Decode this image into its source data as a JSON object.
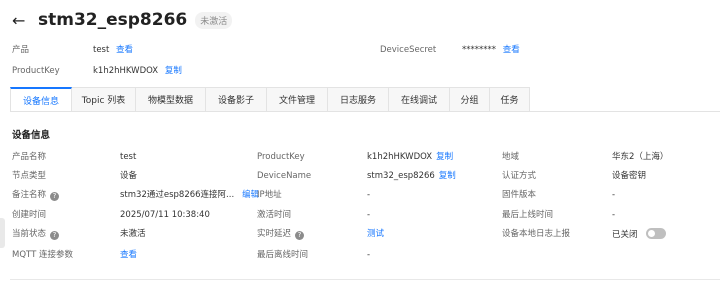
{
  "header": {
    "back_glyph": "←",
    "title": "stm32_esp8266",
    "status": "未激活"
  },
  "meta": {
    "product_label": "产品",
    "product_value": "test",
    "product_link": "查看",
    "secret_label": "DeviceSecret",
    "secret_value": "********",
    "secret_link": "查看",
    "productkey_label": "ProductKey",
    "productkey_value": "k1h2hHKWDOX",
    "productkey_link": "复制"
  },
  "tabs": [
    "设备信息",
    "Topic 列表",
    "物模型数据",
    "设备影子",
    "文件管理",
    "日志服务",
    "在线调试",
    "分组",
    "任务"
  ],
  "section": {
    "title": "设备信息"
  },
  "info": {
    "product_name_label": "产品名称",
    "product_name_value": "test",
    "pk_label": "ProductKey",
    "pk_value": "k1h2hHKWDOX",
    "pk_link": "复制",
    "region_label": "地域",
    "region_value": "华东2（上海）",
    "node_label": "节点类型",
    "node_value": "设备",
    "devname_label": "DeviceName",
    "devname_value": "stm32_esp8266",
    "devname_link": "复制",
    "auth_label": "认证方式",
    "auth_value": "设备密钥",
    "remark_label": "备注名称",
    "remark_value": "stm32通过esp8266连接阿...",
    "remark_link": "编辑",
    "ip_label": "IP地址",
    "ip_value": "-",
    "fw_label": "固件版本",
    "fw_value": "-",
    "created_label": "创建时间",
    "created_value": "2025/07/11 10:38:40",
    "activated_label": "激活时间",
    "activated_value": "-",
    "lastonline_label": "最后上线时间",
    "lastonline_value": "-",
    "state_label": "当前状态",
    "state_value": "未激活",
    "delay_label": "实时延迟",
    "delay_link": "测试",
    "locallog_label": "设备本地日志上报",
    "locallog_value": "已关闭",
    "mqtt_label": "MQTT 连接参数",
    "mqtt_link": "查看",
    "lastoffline_label": "最后离线时间",
    "lastoffline_value": "-"
  }
}
